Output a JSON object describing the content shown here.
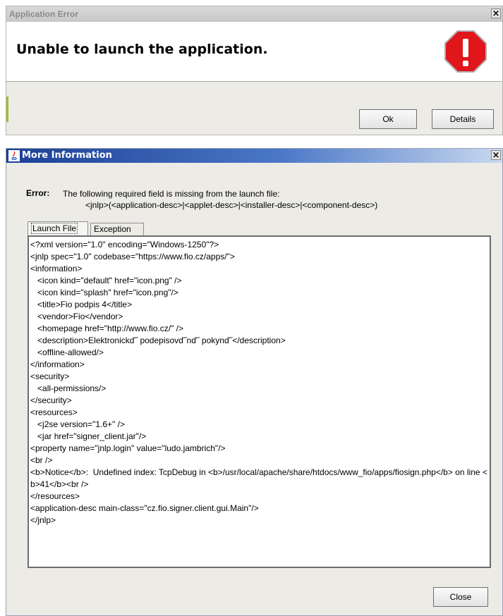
{
  "error_dialog": {
    "title": "Application Error",
    "headline": "Unable to launch the application.",
    "ok_label": "Ok",
    "details_label": "Details",
    "icon": "stop-icon"
  },
  "info_dialog": {
    "title": "More Information",
    "error_label": "Error:",
    "error_message_line1": "The following required field is missing from the launch file:",
    "error_message_line2": "<jnlp>(<application-desc>|<applet-desc>|<installer-desc>|<component-desc>)",
    "tabs": [
      {
        "label": "Launch File"
      },
      {
        "label": "Exception"
      }
    ],
    "close_label": "Close",
    "launch_file_lines": [
      "<?xml version=\"1.0\" encoding=\"Windows-1250\"?>",
      "<jnlp spec=\"1.0\" codebase=\"https://www.fio.cz/apps/\">",
      "<information>",
      "   <icon kind=\"default\" href=\"icon.png\" />",
      "   <icon kind=\"splash\" href=\"icon.png\"/>",
      "   <title>Fio podpis 4</title>",
      "   <vendor>Fio</vendor>",
      "   <homepage href=\"http://www.fio.cz/\" />",
      "   <description>Elektronickď˝ podepisovď˝nď˝ pokynď˝</description>",
      "   <offline-allowed/>",
      "</information>",
      "<security>",
      "   <all-permissions/>",
      "</security>",
      "<resources>",
      "   <j2se version=\"1.6+\" />",
      "   <jar href=\"signer_client.jar\"/>",
      "<property name=\"jnlp.login\" value=\"ludo.jambrich\"/>",
      "<br />",
      "<b>Notice</b>:  Undefined index: TcpDebug in <b>/usr/local/apache/share/htdocs/www_fio/apps/fiosign.php</b> on line <b>41</b><br />",
      "</resources>",
      "<application-desc main-class=\"cz.fio.signer.client.gui.Main\"/>",
      "</jnlp>"
    ]
  }
}
